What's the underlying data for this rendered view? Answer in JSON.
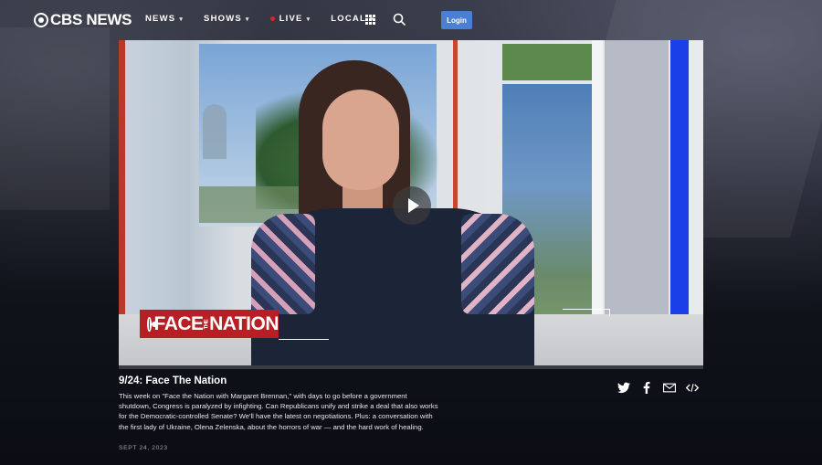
{
  "header": {
    "logo_text": "CBS NEWS",
    "nav": [
      {
        "label": "NEWS"
      },
      {
        "label": "SHOWS"
      },
      {
        "label": "LIVE"
      },
      {
        "label": "LOCAL"
      }
    ],
    "login_label": "Login"
  },
  "video": {
    "show_logo_text": "FACE THE NATION",
    "show_logo_main_1": "FACE",
    "show_logo_small": "THE",
    "show_logo_main_2": "NATION"
  },
  "episode": {
    "title": "9/24: Face The Nation",
    "description": "This week on \"Face the Nation with Margaret Brennan,\" with days to go before a government shutdown, Congress is paralyzed by infighting. Can Republicans unify and strike a deal that also works for the Democratic-controlled Senate? We'll have the latest on negotiations. Plus: a conversation with the first lady of Ukraine, Olena Zelenska, about the horrors of war — and the hard work of healing.",
    "date": "SEPT 24, 2023"
  },
  "share": [
    "twitter-icon",
    "facebook-icon",
    "email-icon",
    "embed-icon"
  ],
  "colors": {
    "accent_blue": "#4a7fd3",
    "live_red": "#e0202e",
    "ftn_red": "#b71f24"
  }
}
